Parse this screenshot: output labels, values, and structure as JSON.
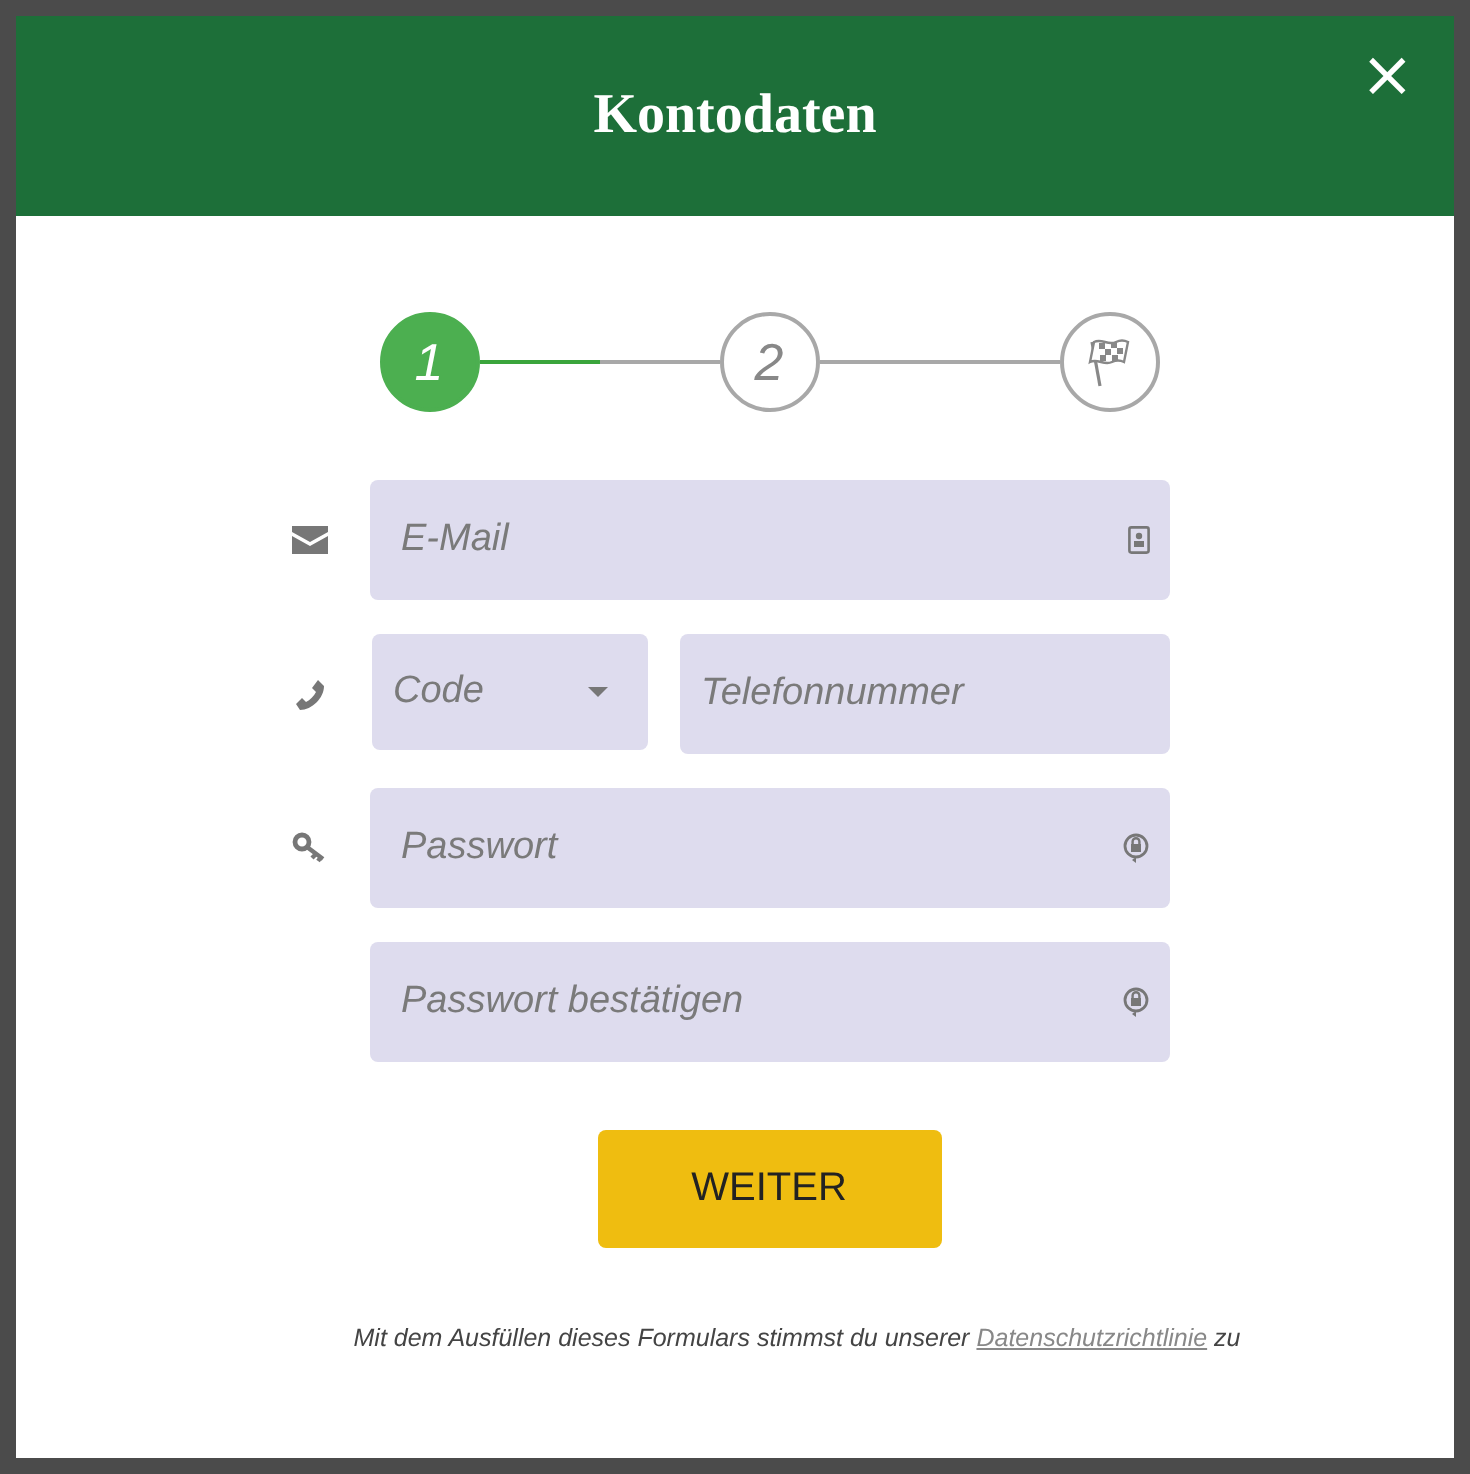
{
  "dialog": {
    "title": "Kontodaten",
    "close": "×"
  },
  "steps": [
    {
      "kind": "number",
      "label": "1",
      "active": true
    },
    {
      "kind": "number",
      "label": "2",
      "active": false
    },
    {
      "kind": "finish",
      "active": false
    }
  ],
  "connectors": [
    {
      "level": 0.5
    }
  ],
  "fields": [
    {
      "kind": "email",
      "placeholder": "E-Mail"
    },
    {
      "kind": "phone",
      "code_placeholder": "Code",
      "placeholder": "Telefonnummer"
    },
    {
      "kind": "password",
      "placeholder": "Passwort"
    },
    {
      "kind": "password-confirm",
      "placeholder": "Passwort bestätigen"
    }
  ],
  "submit": "WEITER",
  "consent": {
    "before": "Mit dem Ausfüllen dieses Formulars stimmst du unserer",
    "link": "Datenschutzrichtlinie",
    "after": "zu"
  }
}
